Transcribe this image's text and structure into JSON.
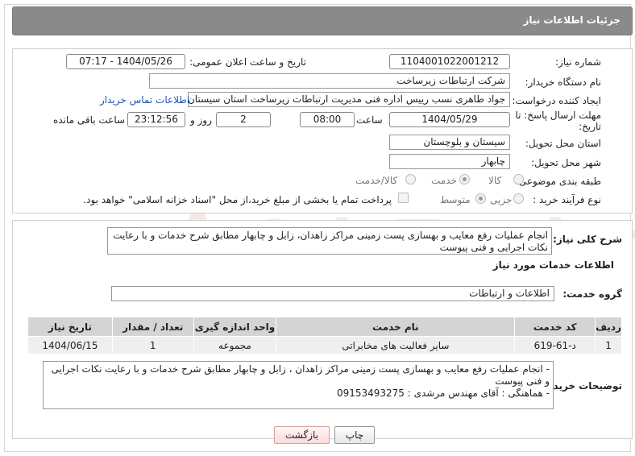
{
  "page_title": "جزئیات اطلاعات نیاز",
  "watermark": "AriaTender.net",
  "form": {
    "need_number_label": "شماره نیاز:",
    "need_number": "1104001022001212",
    "announce_label": "تاریخ و ساعت اعلان عمومی:",
    "announce_value": "1404/05/26 - 07:17",
    "buyer_org_label": "نام دستگاه خریدار:",
    "buyer_org": "شرکت ارتباطات زیرساخت",
    "requester_label": "ایجاد کننده درخواست:",
    "requester": "جواد طاهری نسب رییس اداره فنی مدیریت ارتباطات زیرساخت استان سیستان و",
    "contact_link": "اطلاعات تماس خریدار",
    "deadline_label": "مهلت ارسال پاسخ: تا تاریخ:",
    "deadline_date": "1404/05/29",
    "time_label": "ساعت",
    "deadline_time": "08:00",
    "days_value": "2",
    "days_label": "روز و",
    "remaining_time": "23:12:56",
    "remaining_label": "ساعت باقی مانده",
    "province_label": "استان محل تحویل:",
    "province": "سیستان و بلوچستان",
    "city_label": "شهر محل تحویل:",
    "city": "چابهار",
    "category_label": "طبقه بندی موضوعی:",
    "category_options": [
      "کالا",
      "خدمت",
      "کالا/خدمت"
    ],
    "category_selected": "خدمت",
    "process_label": "نوع فرآیند خرید :",
    "process_options": [
      "جزیی",
      "متوسط"
    ],
    "process_selected": "متوسط",
    "payment_note": "پرداخت تمام یا بخشی از مبلغ خرید،از محل \"اسناد خزانه اسلامی\" خواهد بود."
  },
  "summary": {
    "label": "شرح کلی نیاز:",
    "text": "انجام عملیات رفع معایب و بهسازی پست زمینی مراکز  زاهدان، زابل و چابهار مطابق شرح خدمات و با رعایت نکات اجرایی و فنی پیوست"
  },
  "services": {
    "section_title": "اطلاعات خدمات مورد نیاز",
    "group_label": "گروه خدمت:",
    "group_value": "اطلاعات و ارتباطات",
    "columns": [
      "ردیف",
      "کد خدمت",
      "نام خدمت",
      "واحد اندازه گیری",
      "تعداد / مقدار",
      "تاریخ نیاز"
    ],
    "rows": [
      [
        "1",
        "د-61-619",
        "سایر فعالیت های مخابراتی",
        "مجموعه",
        "1",
        "1404/06/15"
      ]
    ]
  },
  "buyer_notes": {
    "label": "توضیحات خریدار:",
    "line1": "- انجام عملیات رفع معایب و بهسازی پست زمینی مراکز  زاهدان ، زابل و چابهار مطابق شرح خدمات و با رعایت نکات اجرایی و فنی پیوست",
    "line2": "- هماهنگی : آقای مهندس مرشدی : 09153493275"
  },
  "buttons": {
    "print": "چاپ",
    "back": "بازگشت"
  }
}
